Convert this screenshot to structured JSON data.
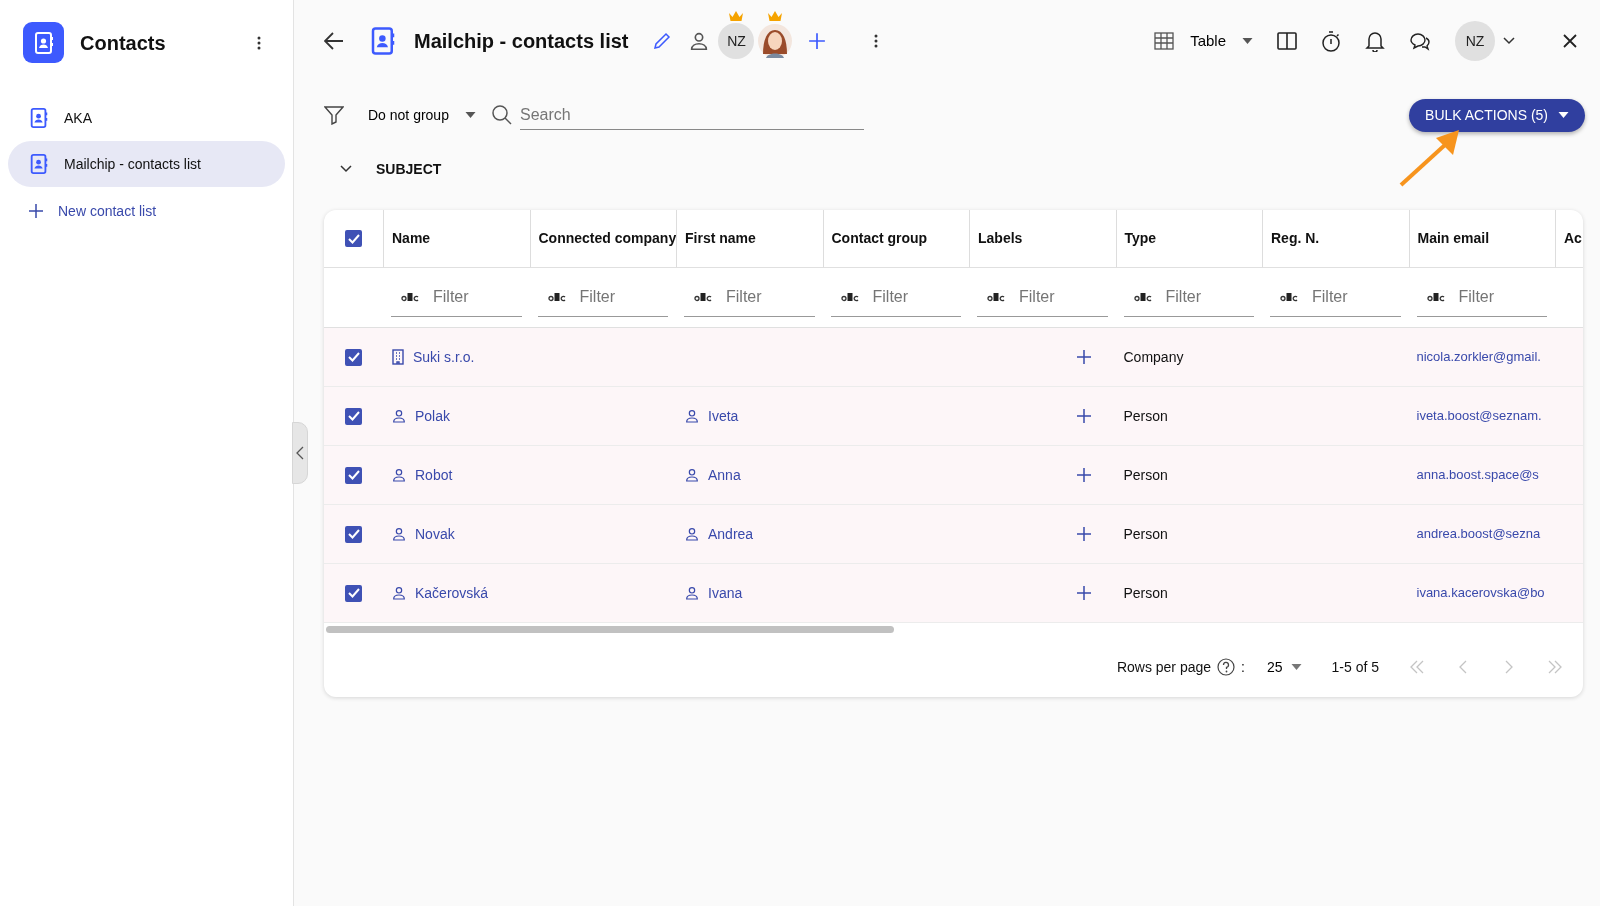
{
  "sidebar": {
    "title": "Contacts",
    "items": [
      {
        "label": "AKA",
        "selected": false
      },
      {
        "label": "Mailchip - contacts list",
        "selected": true
      }
    ],
    "new_item": "New contact list"
  },
  "header": {
    "title": "Mailchip - contacts list",
    "avatar_initials": "NZ",
    "view": "Table",
    "user_initials": "NZ"
  },
  "toolbar": {
    "group_by": "Do not group",
    "search": {
      "placeholder": "Search"
    },
    "bulk_actions": "BULK ACTIONS (5)"
  },
  "group": {
    "label": "SUBJECT",
    "expanded": true
  },
  "table": {
    "all_checked": true,
    "columns": [
      "Name",
      "Connected company",
      "First name",
      "Contact group",
      "Labels",
      "Type",
      "Reg. N.",
      "Main email",
      "Ac"
    ],
    "filters": [
      {
        "placeholder": "Filter"
      },
      {
        "placeholder": "Filter"
      },
      {
        "placeholder": "Filter"
      },
      {
        "placeholder": "Filter"
      },
      {
        "placeholder": "Filter"
      },
      {
        "placeholder": "Filter"
      },
      {
        "placeholder": "Filter"
      },
      {
        "placeholder": "Filter"
      }
    ],
    "rows": [
      {
        "checked": true,
        "kind": "company",
        "name": "Suki s.r.o.",
        "first_name": "",
        "type": "Company",
        "email": "nicola.zorkler@gmail."
      },
      {
        "checked": true,
        "kind": "person",
        "name": "Polak",
        "first_name": "Iveta",
        "type": "Person",
        "email": "iveta.boost@seznam."
      },
      {
        "checked": true,
        "kind": "person",
        "name": "Robot",
        "first_name": "Anna",
        "type": "Person",
        "email": "anna.boost.space@s"
      },
      {
        "checked": true,
        "kind": "person",
        "name": "Novak",
        "first_name": "Andrea",
        "type": "Person",
        "email": "andrea.boost@sezna"
      },
      {
        "checked": true,
        "kind": "person",
        "name": "Kačerovská",
        "first_name": "Ivana",
        "type": "Person",
        "email": "ivana.kacerovska@bo"
      }
    ]
  },
  "pagination": {
    "rows_per_page_label": "Rows per page",
    "separator": ":",
    "rows_per_page": "25",
    "range": "1-5 of 5",
    "buttons": [
      {
        "kind": "first",
        "disabled": true
      },
      {
        "kind": "prev",
        "disabled": true
      },
      {
        "kind": "next",
        "disabled": true
      },
      {
        "kind": "last",
        "disabled": true
      }
    ]
  }
}
